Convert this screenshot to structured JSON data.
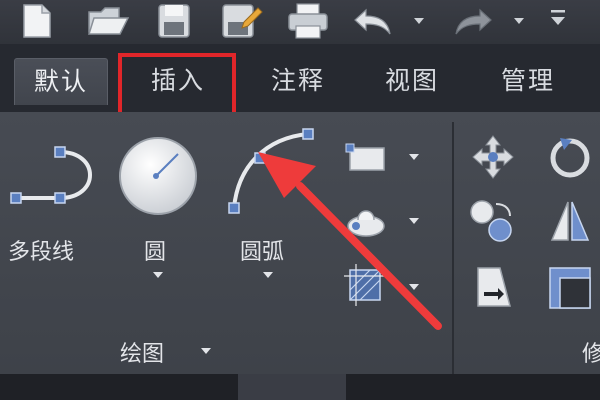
{
  "ribbon_tabs": [
    {
      "label": "默认",
      "active": true
    },
    {
      "label": "插入",
      "active": false,
      "highlighted": true
    },
    {
      "label": "注释",
      "active": false
    },
    {
      "label": "视图",
      "active": false
    },
    {
      "label": "管理",
      "active": false
    }
  ],
  "draw_panel": {
    "title": "绘图",
    "tools": {
      "polyline": "多段线",
      "circle": "圆",
      "arc": "圆弧"
    }
  },
  "side_panel": {
    "title_fragment": "修"
  },
  "colors": {
    "highlight_box": "#e0262a",
    "arrow": "#ee3b3b",
    "tab_active_bg": "#4a4e57",
    "ribbon_bg": "#474b53"
  },
  "icons": [
    "new-file-icon",
    "open-folder-icon",
    "save-icon",
    "save-as-icon",
    "print-icon",
    "undo-icon",
    "redo-icon",
    "customize-toolbar-icon",
    "polyline-icon",
    "circle-icon",
    "arc-icon",
    "rectangle-icon",
    "hatch-icon",
    "region-icon",
    "move-icon",
    "rotate-icon",
    "copy-icon",
    "mirror-icon",
    "stretch-icon",
    "scale-icon"
  ]
}
